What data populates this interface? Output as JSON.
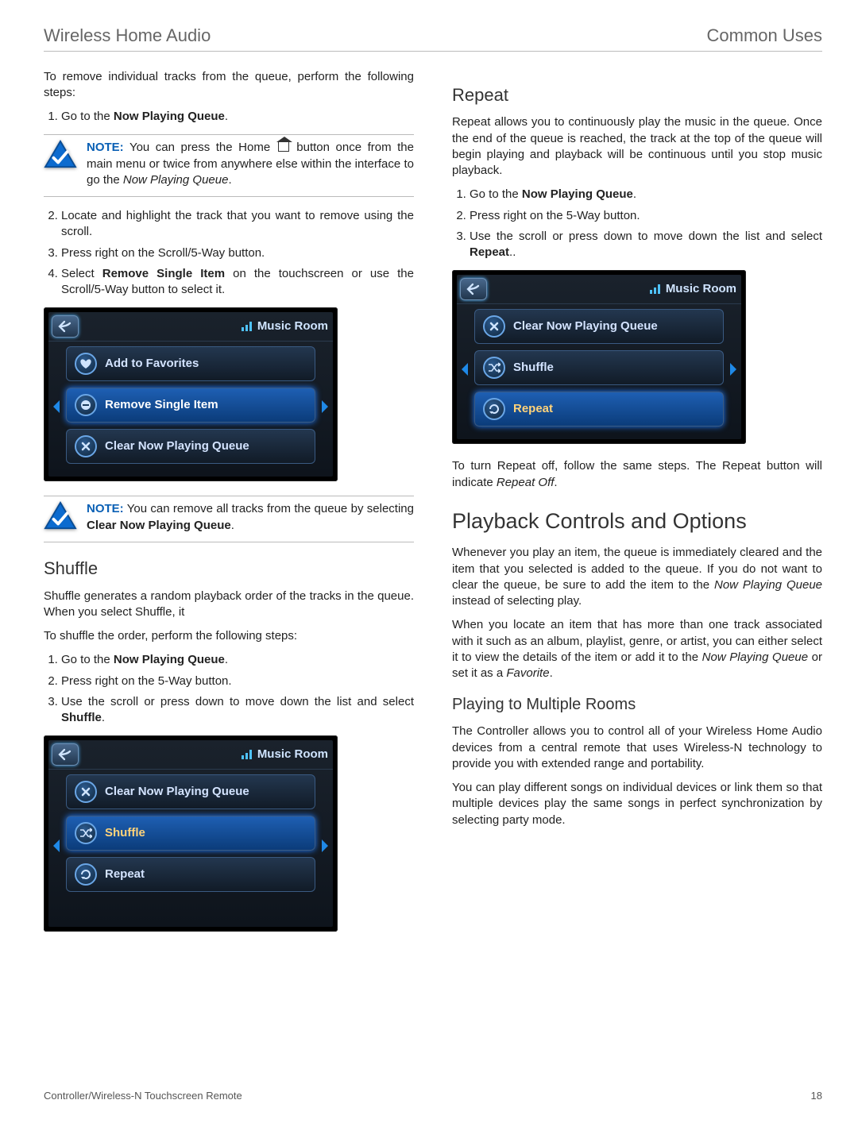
{
  "header": {
    "left": "Wireless Home Audio",
    "right": "Common Uses"
  },
  "footer": {
    "left": "Controller/Wireless-N Touchscreen Remote",
    "page": "18"
  },
  "left": {
    "intro": "To remove individual tracks from the queue, perform the following steps:",
    "steps1": {
      "s1a": "Go to the ",
      "s1b": "Now Playing Queue",
      "s1c": ".",
      "s2": "Locate and highlight the track that you want to remove using the scroll.",
      "s3": "Press right on the Scroll/5-Way button.",
      "s4a": "Select ",
      "s4b": "Remove Single Item",
      "s4c": " on the touchscreen or use the Scroll/5-Way button to select it."
    },
    "note1": {
      "label": "NOTE:",
      "t1": " You can press the Home ",
      "t2": " button once from the main menu or twice from anywhere else within the interface to go the ",
      "t3": "Now Playing Queue",
      "t4": "."
    },
    "note2": {
      "label": "NOTE:",
      "t1": " You can remove all tracks from the queue by selecting ",
      "t2": "Clear Now Playing Queue",
      "t3": "."
    },
    "shuffle": {
      "h": "Shuffle",
      "p1": "Shuffle generates a random playback order of the tracks in the queue. When you select Shuffle, it",
      "p2": "To shuffle the order, perform the following steps:",
      "s1a": "Go to the ",
      "s1b": "Now Playing Queue",
      "s1c": ".",
      "s2": "Press right on the 5-Way button.",
      "s3a": "Use the scroll or press down to move down the list and select ",
      "s3b": "Shuffle",
      "s3c": "."
    }
  },
  "right": {
    "repeat": {
      "h": "Repeat",
      "p1": "Repeat allows you to continuously play the music in the queue. Once the end of the queue is reached, the track at the top of the queue will begin playing and playback will be continuous until you stop music playback.",
      "s1a": "Go to the ",
      "s1b": "Now Playing Queue",
      "s1c": ".",
      "s2": "Press right on the 5-Way button.",
      "s3a": "Use the scroll or press down to move down the list and select ",
      "s3b": "Repeat",
      "s3c": "..",
      "off1": "To turn Repeat off, follow the same steps. The Repeat button will indicate ",
      "off2": "Repeat Off",
      "off3": "."
    },
    "pbc": {
      "h": "Playback Controls and Options",
      "p1a": "Whenever you play an item, the queue is immediately cleared and the item that you selected is added to the queue. If you do not want to clear the queue, be sure to add the item to the ",
      "p1b": "Now Playing Queue",
      "p1c": " instead of selecting play.",
      "p2a": "When you locate an item that has more than one track associated with it such as an album, playlist, genre, or artist, you can either select it to view the details of the item or add it to the ",
      "p2b": "Now Playing Queue",
      "p2c": " or set it as a ",
      "p2d": "Favorite",
      "p2e": "."
    },
    "rooms": {
      "h": "Playing to Multiple Rooms",
      "p1": "The Controller allows you to control all of your Wireless Home Audio devices from a central remote that uses Wireless-N technology to provide you with extended range and portability.",
      "p2": "You can play different songs on individual devices or link them so that multiple devices play the same songs in perfect synchronization by selecting party mode."
    }
  },
  "screens": {
    "room": "Music Room",
    "s1": {
      "i1": "Add to Favorites",
      "i2": "Remove Single Item",
      "i3": "Clear Now Playing Queue"
    },
    "s2": {
      "i1": "Clear Now Playing Queue",
      "i2": "Shuffle",
      "i3": "Repeat"
    },
    "s3": {
      "i1": "Clear Now Playing Queue",
      "i2": "Shuffle",
      "i3": "Repeat"
    }
  }
}
